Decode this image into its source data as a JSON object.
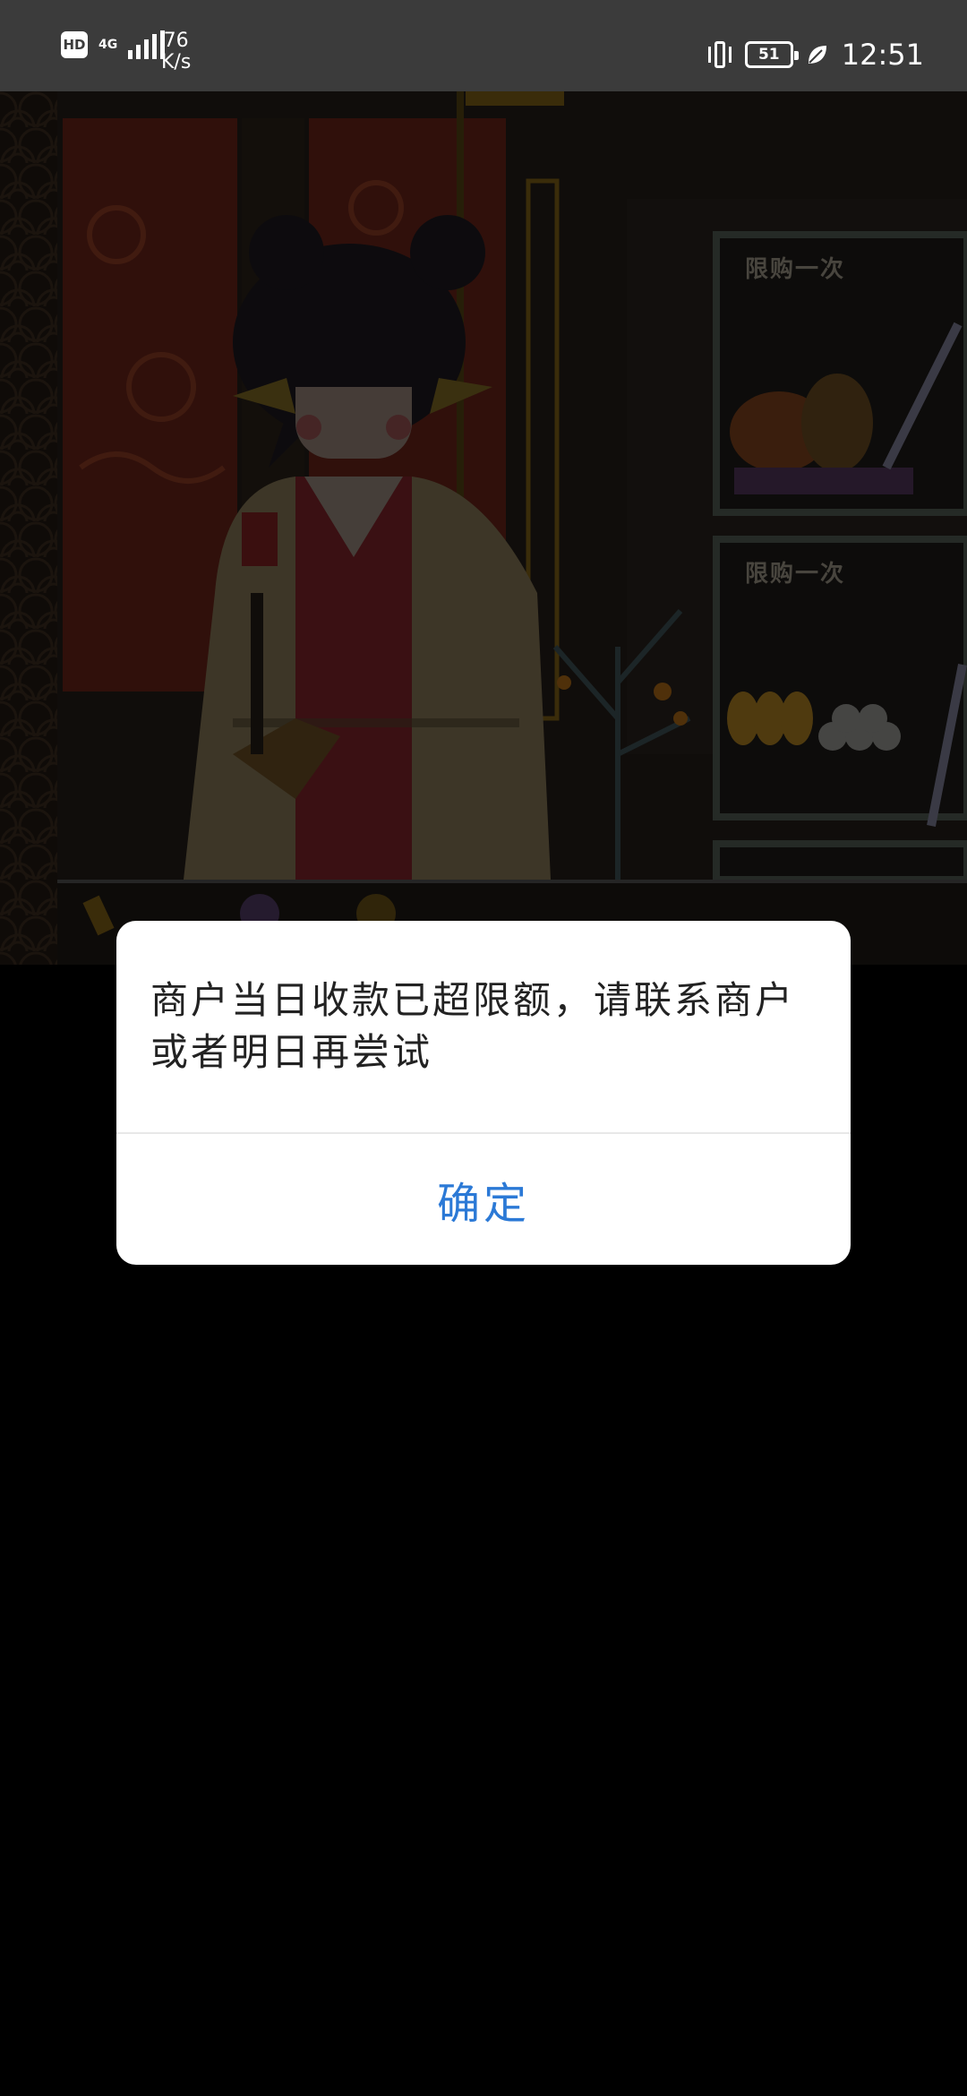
{
  "status_bar": {
    "hd_label": "HD",
    "network_type": "4G",
    "speed_value": "76",
    "speed_unit": "K/s",
    "battery_level": "51",
    "time": "12:51"
  },
  "game": {
    "shop_slot_1_label": "限购一次",
    "shop_slot_2_label": "限购一次"
  },
  "dialog": {
    "message": "商户当日收款已超限额，请联系商户或者明日再尝试",
    "confirm_label": "确定",
    "confirm_color": "#2b79d6"
  }
}
